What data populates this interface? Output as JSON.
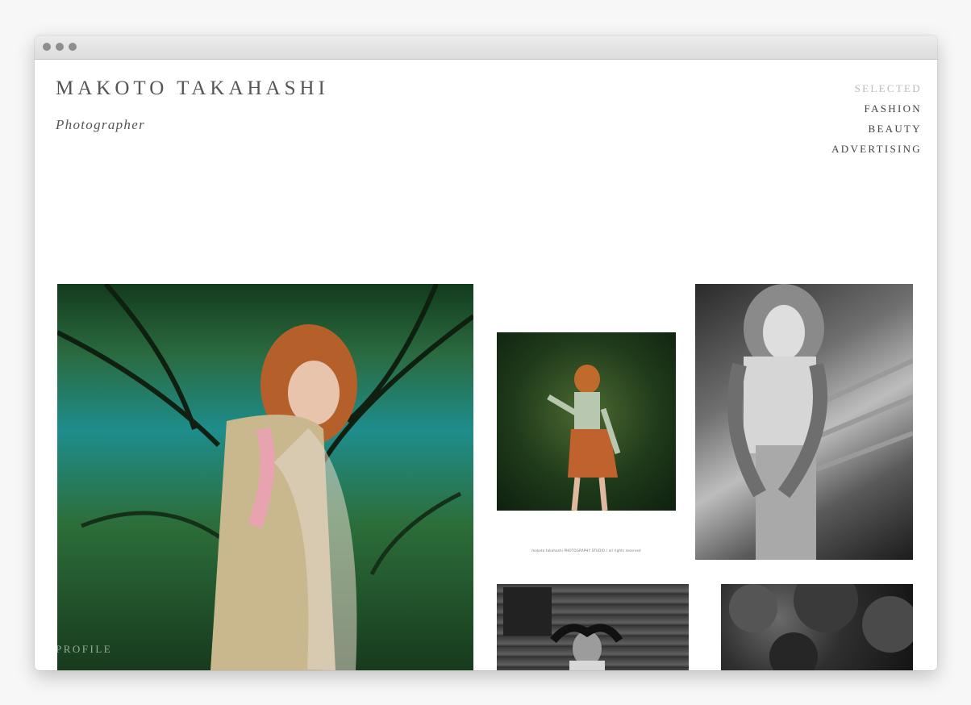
{
  "site": {
    "name": "MAKOTO TAKAHASHI",
    "role": "Photographer"
  },
  "nav": {
    "items": [
      {
        "label": "SELECTED",
        "active": true
      },
      {
        "label": "FASHION",
        "active": false
      },
      {
        "label": "BEAUTY",
        "active": false
      },
      {
        "label": "ADVERTISING",
        "active": false
      }
    ]
  },
  "gallery": {
    "caption": "makoto takahashi PHOTOGRAPHY STUDIO / all rights reserved",
    "photos": [
      {
        "name": "photo-red-hair-ruffle-jacket",
        "tone": "color"
      },
      {
        "name": "photo-plaid-dress-forest",
        "tone": "color"
      },
      {
        "name": "photo-bw-fence",
        "tone": "monochrome"
      },
      {
        "name": "photo-bw-log-cabin",
        "tone": "monochrome"
      },
      {
        "name": "photo-bw-trees",
        "tone": "monochrome"
      }
    ]
  },
  "footer": {
    "link_label": "PROFILE"
  }
}
